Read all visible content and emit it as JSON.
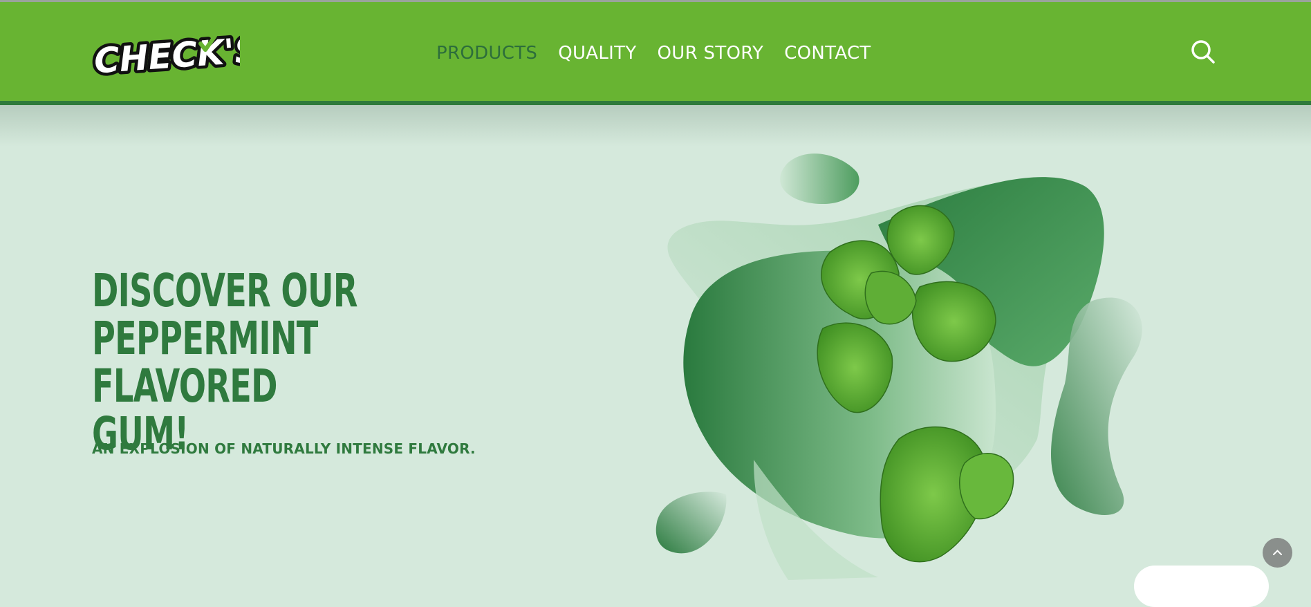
{
  "brand": {
    "name": "CHECK'S"
  },
  "nav": {
    "items": [
      {
        "label": "PRODUCTS",
        "active": true
      },
      {
        "label": "QUALITY",
        "active": false
      },
      {
        "label": "OUR STORY",
        "active": false
      },
      {
        "label": "CONTACT",
        "active": false
      }
    ],
    "search_icon": "search-icon"
  },
  "hero": {
    "title_lines": [
      "DISCOVER OUR",
      "PEPPERMINT",
      "FLAVORED GUM!"
    ],
    "subtitle": "AN EXPLOSION OF NATURALLY INTENSE FLAVOR."
  },
  "colors": {
    "header": "#68b432",
    "header_border": "#2e7a3a",
    "background": "#d5e9dc",
    "title": "#2f7a3e",
    "nav_active": "#2d6e3b"
  },
  "icons": {
    "scroll_top": "chevron-up-icon"
  }
}
